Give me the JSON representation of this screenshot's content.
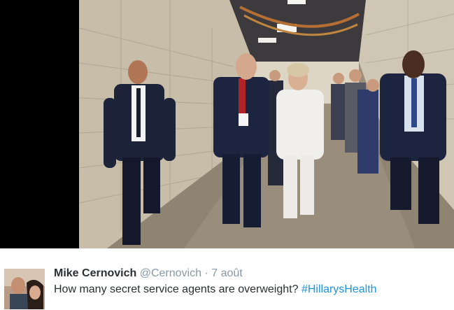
{
  "tweet": {
    "author_name": "Mike Cernovich",
    "handle": "@Cernovich",
    "separator": "·",
    "date": "7 août",
    "text": "How many secret service agents are overweight?",
    "hashtag": "#HillarysHealth"
  },
  "colors": {
    "name": "#292f33",
    "meta": "#8899a6",
    "hashtag": "#1b95e0"
  }
}
